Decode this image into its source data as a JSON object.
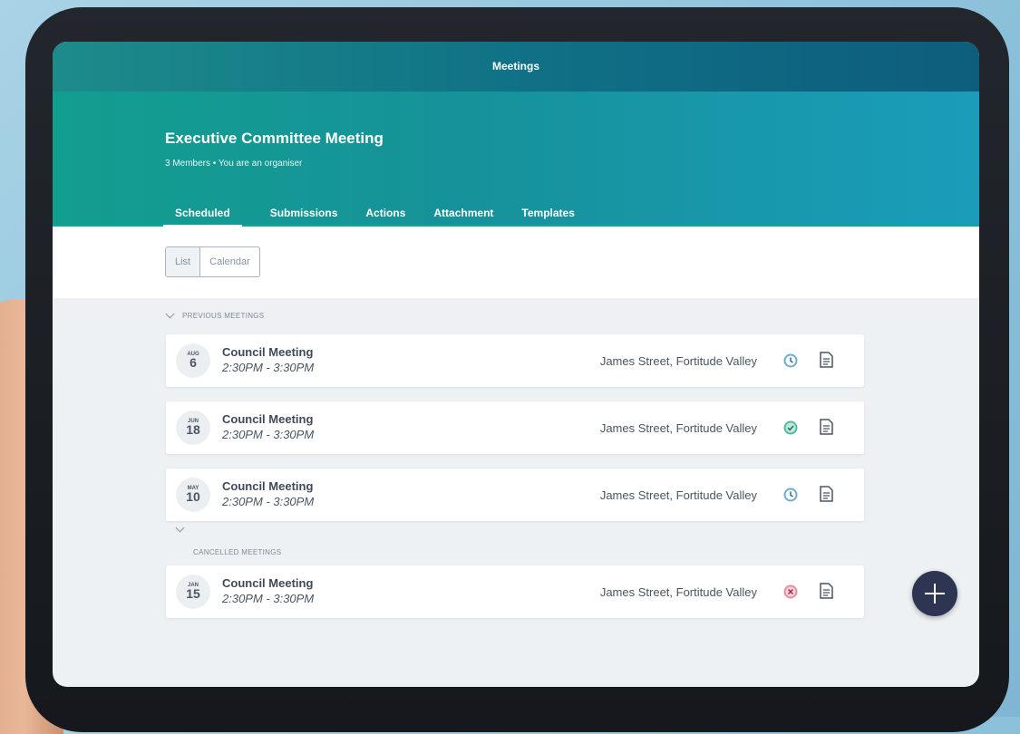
{
  "app": {
    "title": "Meetings"
  },
  "group": {
    "name": "Executive Committee Meeting",
    "subtitle": "3 Members • You are an organiser"
  },
  "tabs": [
    {
      "label": "Scheduled",
      "active": true
    },
    {
      "label": "Submissions"
    },
    {
      "label": "Actions"
    },
    {
      "label": "Attachment"
    },
    {
      "label": "Templates"
    }
  ],
  "view_toggle": {
    "list": "List",
    "calendar": "Calendar",
    "selected": "List"
  },
  "sections": {
    "previous": "PREVIOUS MEETINGS",
    "cancelled": "CANCELLED MEETINGS"
  },
  "meetings": [
    {
      "month": "AUG",
      "day": "6",
      "title": "Council Meeting",
      "time": "2:30PM - 3:30PM",
      "location": "James Street, Fortitude Valley",
      "status": "scheduled",
      "status_icon": "clock-icon"
    },
    {
      "month": "JUN",
      "day": "18",
      "title": "Council Meeting",
      "time": "2:30PM - 3:30PM",
      "location": "James Street, Fortitude Valley",
      "status": "completed",
      "status_icon": "check-icon"
    },
    {
      "month": "MAY",
      "day": "10",
      "title": "Council Meeting",
      "time": "2:30PM - 3:30PM",
      "location": "James Street, Fortitude Valley",
      "status": "scheduled",
      "status_icon": "clock-icon"
    }
  ],
  "cancelled": [
    {
      "month": "JAN",
      "day": "15",
      "title": "Council Meeting",
      "time": "2:30PM - 3:30PM",
      "location": "James Street, Fortitude Valley",
      "status": "cancelled",
      "status_icon": "cancel-icon"
    }
  ],
  "colors": {
    "clock": "#6aaed8",
    "check": "#54b9a3",
    "cancel": "#e58fa2",
    "fab": "#2e3553"
  }
}
